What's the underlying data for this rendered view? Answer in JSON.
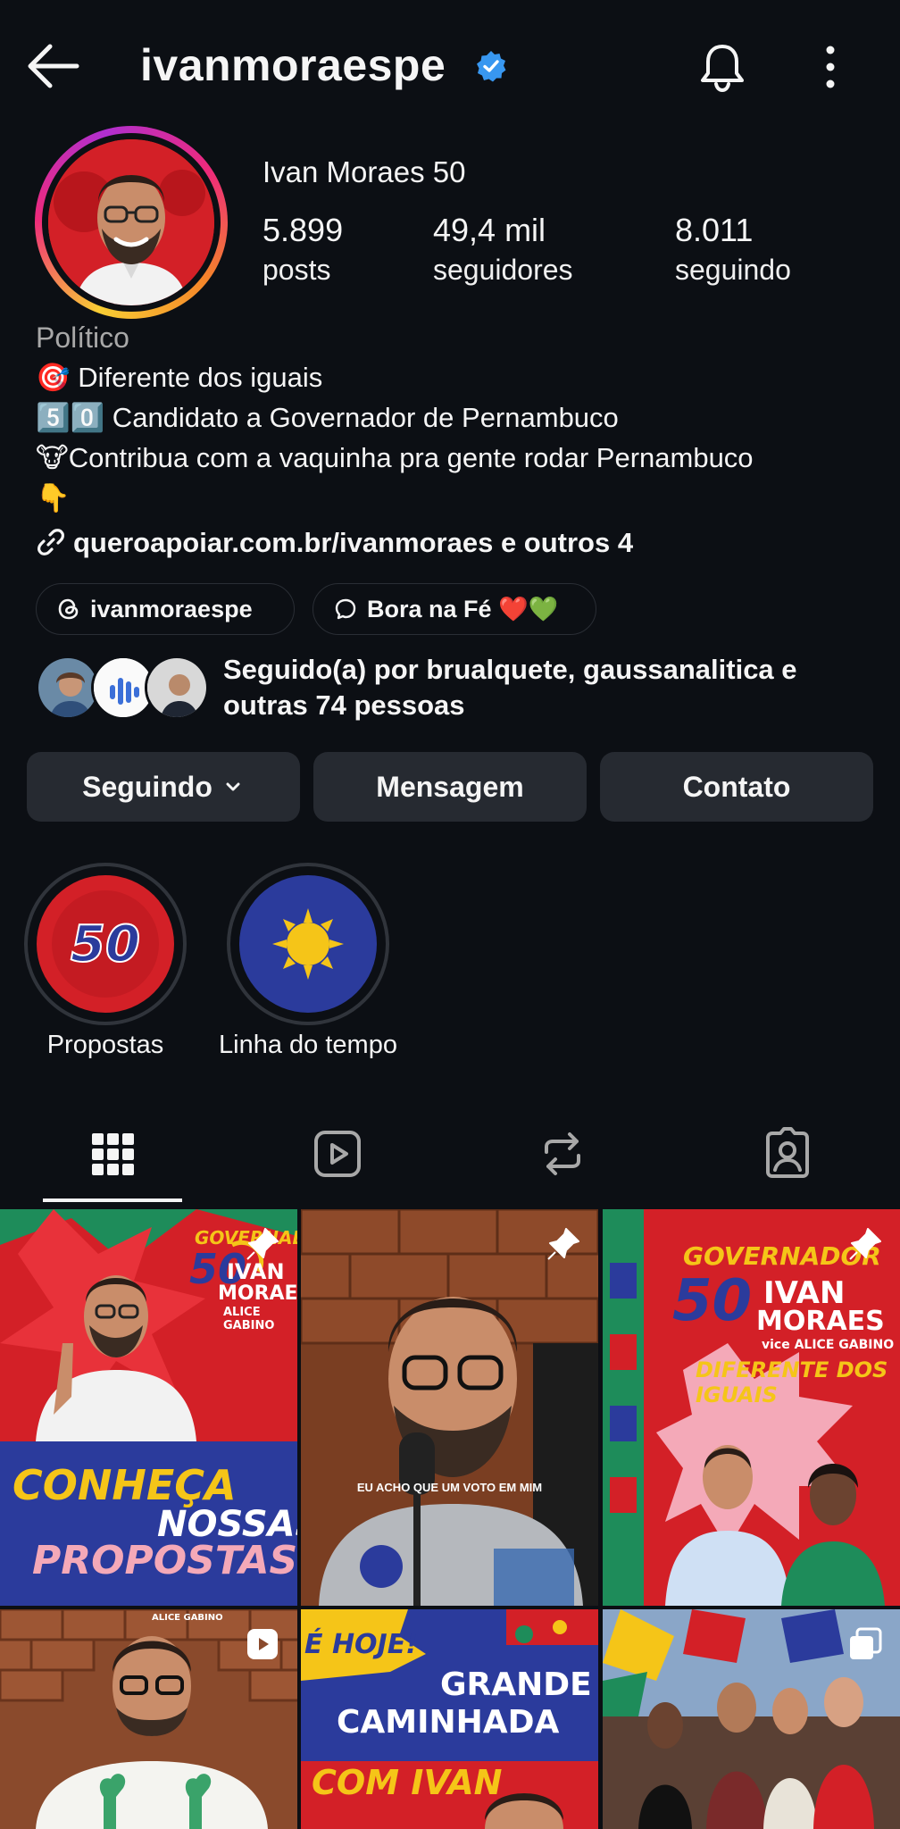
{
  "header": {
    "username": "ivanmoraespe",
    "verified": true,
    "icons": [
      "back-arrow-icon",
      "verified-badge-icon",
      "bell-icon",
      "more-vertical-icon"
    ]
  },
  "profile": {
    "display_name": "Ivan Moraes 50",
    "stats": {
      "posts": {
        "value": "5.899",
        "label": "posts"
      },
      "followers": {
        "value": "49,4 mil",
        "label": "seguidores"
      },
      "following": {
        "value": "8.011",
        "label": "seguindo"
      }
    },
    "category": "Político",
    "bio": [
      "🎯 Diferente dos iguais",
      "5️⃣0️⃣ Candidato a Governador de Pernambuco",
      "🐮Contribua com a vaquinha pra gente rodar Pernambuco",
      "👇"
    ],
    "link": "queroapoiar.com.br/ivanmoraes e outros 4"
  },
  "chips": {
    "threads": "ivanmoraespe",
    "thread_post": "Bora na Fé ❤️💚"
  },
  "followed_by": {
    "line1": "Seguido(a) por brualquete, gaussanalitica e",
    "line2": "outras 74 pessoas"
  },
  "actions": {
    "following": "Seguindo",
    "message": "Mensagem",
    "contact": "Contato"
  },
  "highlights": [
    {
      "label": "Propostas",
      "cover_text": "50"
    },
    {
      "label": "Linha do tempo",
      "cover_text": ""
    }
  ],
  "tabs": [
    "grid-icon",
    "reels-icon",
    "reposts-icon",
    "tagged-icon"
  ],
  "posts": {
    "p1": {
      "top": "GOVERNADOR",
      "num": "50",
      "name1": "IVAN",
      "name2": "MORAES",
      "vice": "ALICE GABINO",
      "bottom1": "CONHEÇA",
      "bottom2": "NOSSAS",
      "bottom3": "PROPOSTAS"
    },
    "p2": {
      "caption": "EU ACHO QUE UM VOTO EM MIM"
    },
    "p3": {
      "top": "GOVERNADOR",
      "num": "50",
      "name1": "IVAN",
      "name2": "MORAES",
      "vice": "vice ALICE GABINO",
      "slogan": "DIFERENTE DOS IGUAIS"
    },
    "p4": {
      "top": "ALICE GABINO"
    },
    "p5": {
      "line1": "É HOJE!",
      "line2": "GRANDE",
      "line3": "CAMINHADA",
      "line4": "COM IVAN"
    },
    "p6": {}
  },
  "colors": {
    "background": "#0c0f14",
    "button": "#262a31",
    "verified": "#3897f0",
    "brand_red": "#d32027",
    "brand_blue": "#2b3b9c",
    "brand_green": "#1e8c5a",
    "brand_yellow": "#f5c518"
  }
}
